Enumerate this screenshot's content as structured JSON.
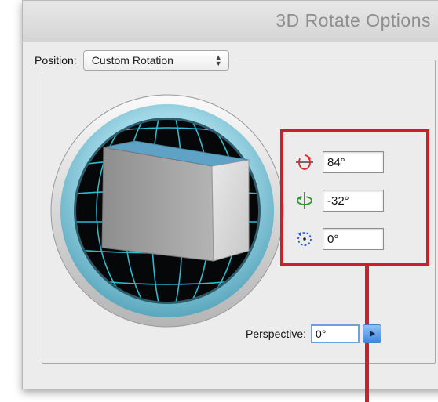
{
  "dialog": {
    "title": "3D Rotate Options"
  },
  "position": {
    "label": "Position:",
    "selected": "Custom Rotation"
  },
  "rotation": {
    "x_value": "84°",
    "y_value": "-32°",
    "z_value": "0°"
  },
  "perspective": {
    "label": "Perspective:",
    "value": "0°"
  },
  "colors": {
    "callout": "#cc1f2b",
    "trackball_ring": "#7fc7d9",
    "grid": "#2bbcd0",
    "x_axis_icon": "#d62b2b",
    "y_axis_icon": "#2a9a2a",
    "z_axis_icon": "#2a5fd6"
  },
  "icons": {
    "x_axis": "rotate-x-axis-icon",
    "y_axis": "rotate-y-axis-icon",
    "z_axis": "rotate-z-axis-icon",
    "trackball": "3d-trackball-cube",
    "perspective_button": "play-arrow-icon",
    "select_arrows": "up-down-arrows-icon"
  }
}
